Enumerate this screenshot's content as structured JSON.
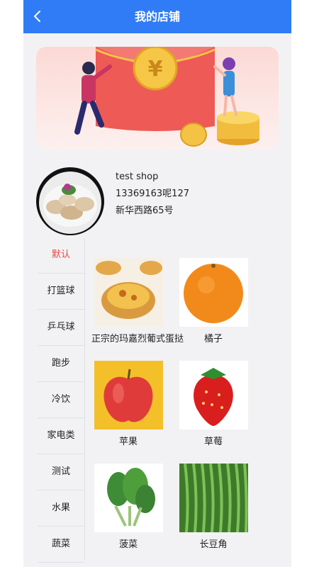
{
  "header": {
    "title": "我的店铺"
  },
  "shop": {
    "name": "test shop",
    "phone": "13369163呢127",
    "address": "新华西路65号"
  },
  "categories": [
    "默认",
    "打篮球",
    "乒乓球",
    "跑步",
    "冷饮",
    "家电类",
    "测试",
    "水果",
    "蔬菜"
  ],
  "products": [
    {
      "name": "正宗的玛嘉烈葡式蛋挞"
    },
    {
      "name": "橘子"
    },
    {
      "name": "苹果"
    },
    {
      "name": "草莓"
    },
    {
      "name": "菠菜"
    },
    {
      "name": "长豆角"
    }
  ],
  "colors": {
    "header": "#2f7cf6",
    "active_category": "#e5463f",
    "background": "#f2f2f4"
  }
}
